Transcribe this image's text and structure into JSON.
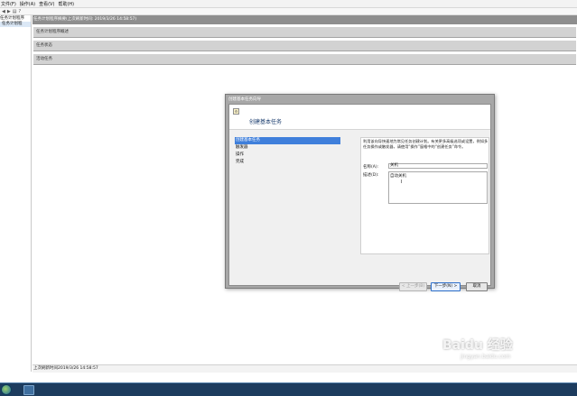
{
  "menubar": {
    "items": [
      "文件(F)",
      "操作(A)",
      "查看(V)",
      "帮助(H)"
    ]
  },
  "toolbar": {
    "back_icon": "back-arrow-icon",
    "forward_icon": "forward-arrow-icon",
    "back_glyph": "◀",
    "forward_glyph": "▶",
    "view_glyph": "▤",
    "help_glyph": "?"
  },
  "tree": {
    "root": "任务计划程序",
    "child": "任务计划程"
  },
  "main": {
    "header": "任务计划程序摘要(上次刷新时间: 2019/3/26 14:58:57)",
    "sections": [
      "任务计划程序概述",
      "任务状态",
      "活动任务"
    ]
  },
  "dialog": {
    "window_title": "创建基本任务向导",
    "heading": "创建基本任务",
    "icon_glyph": "⚙",
    "steps": [
      "创建基本任务",
      "触发器",
      "操作",
      "完成"
    ],
    "intro": "利用该向导快速地为常见任务创建计划。有关更多高级选项或设置，例如多任务操作或触发器，请使用“操作”窗格中的“创建任务”命令。",
    "name_label": "名称(A):",
    "name_value": "关机",
    "desc_label": "描述(D):",
    "desc_value": "自动关机",
    "caret_glyph": "I",
    "buttons": {
      "back": "< 上一步(B)",
      "next": "下一步(N) >",
      "cancel": "取消"
    }
  },
  "statusbar": {
    "text": "上次刷新时间2019/3/26 14:58:57"
  },
  "watermark": {
    "logo": "Baidu 经验",
    "url": "jingyan.baidu.com"
  }
}
